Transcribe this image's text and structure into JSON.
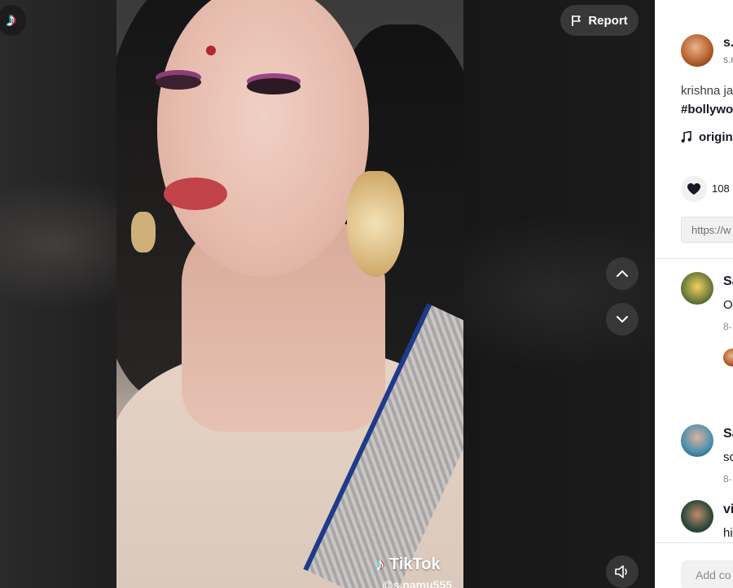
{
  "app": {
    "logo_icon": "tiktok-logo-icon"
  },
  "video": {
    "watermark_brand": "TikTok",
    "watermark_handle": "@s.namu555",
    "report_label": "Report"
  },
  "controls": {
    "prev_icon": "chevron-up-icon",
    "next_icon": "chevron-down-icon",
    "volume_icon": "volume-icon"
  },
  "post": {
    "author_name": "s.",
    "author_handle": "s.n",
    "caption": "krishna ja",
    "hashtag": "#bollywo",
    "music": "origin",
    "likes": "108",
    "link_value": "https://w"
  },
  "comments": [
    {
      "name": "Sa",
      "text": "O",
      "meta": "8-"
    },
    {
      "name": "Sa",
      "text": "sc",
      "meta": "8-"
    },
    {
      "name": "vi",
      "text": "hi",
      "meta": ""
    }
  ],
  "comment_input": {
    "placeholder": "Add co"
  },
  "colors": {
    "panel_bg": "#ffffff",
    "text": "#161823",
    "muted": "#8a8b91"
  }
}
